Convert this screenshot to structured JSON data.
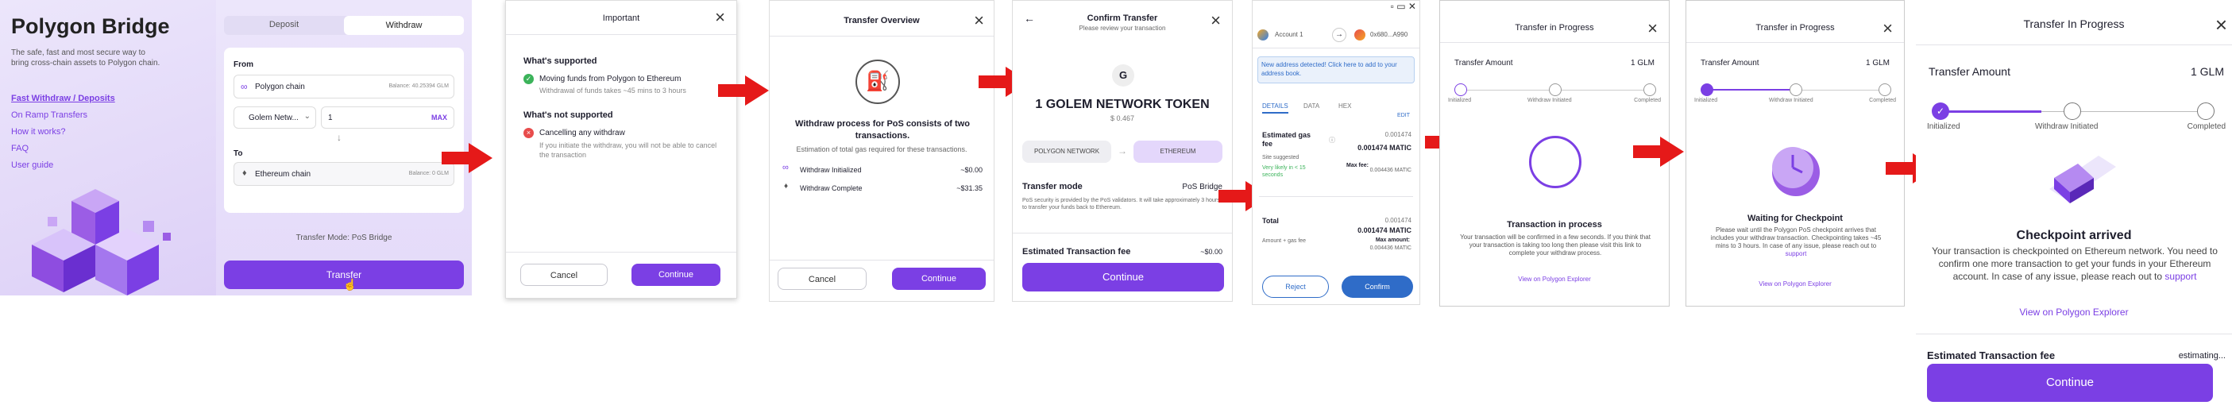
{
  "p1": {
    "title": "Polygon Bridge",
    "desc": "The safe, fast and most secure way to bring cross-chain assets to Polygon chain.",
    "links": [
      "Fast Withdraw / Deposits",
      "On Ramp Transfers",
      "How it works?",
      "FAQ",
      "User guide"
    ]
  },
  "p2": {
    "tabs": [
      "Deposit",
      "Withdraw"
    ],
    "from_label": "From",
    "from_chain": "Polygon chain",
    "from_balance": "Balance: 40.25394 GLM",
    "token": "Golem Netw...",
    "amount": "1",
    "max": "MAX",
    "to_label": "To",
    "to_chain": "Ethereum chain",
    "to_balance": "Balance: 0 GLM",
    "mode": "Transfer Mode: PoS Bridge",
    "transfer": "Transfer"
  },
  "p3": {
    "title": "Important",
    "supported_h": "What's supported",
    "supported_t": "Moving funds from Polygon to Ethereum",
    "supported_s": "Withdrawal of funds takes ~45 mins to 3 hours",
    "not_h": "What's not supported",
    "not_t": "Cancelling any withdraw",
    "not_s": "If you initiate the withdraw, you will not be able to cancel the transaction",
    "cancel": "Cancel",
    "continue": "Continue"
  },
  "p4": {
    "title": "Transfer Overview",
    "heading": "Withdraw process for PoS consists of two transactions.",
    "est": "Estimation of total gas required for these transactions.",
    "rows": [
      {
        "label": "Withdraw Initialized",
        "value": "~$0.00"
      },
      {
        "label": "Withdraw Complete",
        "value": "~$31.35"
      }
    ],
    "cancel": "Cancel",
    "continue": "Continue"
  },
  "p5": {
    "title": "Confirm Transfer",
    "subtitle": "Please review your transaction",
    "amount": "1 GOLEM NETWORK TOKEN",
    "usd": "$ 0.467",
    "from": "POLYGON NETWORK",
    "to": "ETHEREUM",
    "mode_l": "Transfer mode",
    "mode_v": "PoS Bridge",
    "note": "PoS security is provided by the PoS validators. It will take approximately 3 hours to transfer your funds back to Ethereum.",
    "fee_l": "Estimated Transaction fee",
    "fee_v": "~$0.00",
    "continue": "Continue"
  },
  "p6": {
    "account": "Account 1",
    "address": "0x680...A990",
    "notice": "New address detected! Click here to add to your address book.",
    "tabs": [
      "DETAILS",
      "DATA",
      "HEX"
    ],
    "edit": "EDIT",
    "gas_l": "Estimated gas fee",
    "gas_a": "0.001474",
    "gas_m": "0.001474 MATIC",
    "site": "Site suggested",
    "likely": "Very likely in < 15 seconds",
    "max_fee": "Max fee:",
    "max_v": "0.004436 MATIC",
    "total_l": "Total",
    "total_a": "0.001474",
    "total_m": "0.001474 MATIC",
    "amt_gas": "Amount + gas fee",
    "max_amt": "Max amount:",
    "max_amt_v": "0.004436 MATIC",
    "reject": "Reject",
    "confirm": "Confirm"
  },
  "p7": {
    "title": "Transfer in Progress",
    "amount_l": "Transfer Amount",
    "amount_v": "1 GLM",
    "steps": [
      "Initialized",
      "Withdraw Initiated",
      "Completed"
    ],
    "status": "Transaction in process",
    "desc": "Your transaction will be confirmed in a few seconds. If you think that your transaction is taking too long then please visit this link to complete your withdraw process.",
    "link": "View on Polygon Explorer"
  },
  "p8": {
    "title": "Transfer in Progress",
    "amount_l": "Transfer Amount",
    "amount_v": "1 GLM",
    "steps": [
      "Initialized",
      "Withdraw Initiated",
      "Completed"
    ],
    "status": "Waiting for Checkpoint",
    "desc": "Please wait until the Polygon PoS checkpoint arrives that includes your withdraw transaction. Checkpointing takes ~45 mins to 3 hours. In case of any issue, please reach out to",
    "support": "support",
    "link": "View on Polygon Explorer"
  },
  "p9": {
    "title": "Transfer In Progress",
    "amount_l": "Transfer Amount",
    "amount_v": "1 GLM",
    "steps": [
      "Initialized",
      "Withdraw Initiated",
      "Completed"
    ],
    "status": "Checkpoint arrived",
    "desc": "Your transaction is checkpointed on Ethereum network. You need to confirm one more transaction to get your funds in your Ethereum account. In case of any issue, please reach out to",
    "support": "support",
    "link": "View on Polygon Explorer",
    "fee_l": "Estimated Transaction fee",
    "fee_v": "estimating...",
    "continue": "Continue"
  },
  "colors": {
    "accent": "#7b3fe4",
    "arrow": "#e51919",
    "panel": "#e9e2fb"
  }
}
